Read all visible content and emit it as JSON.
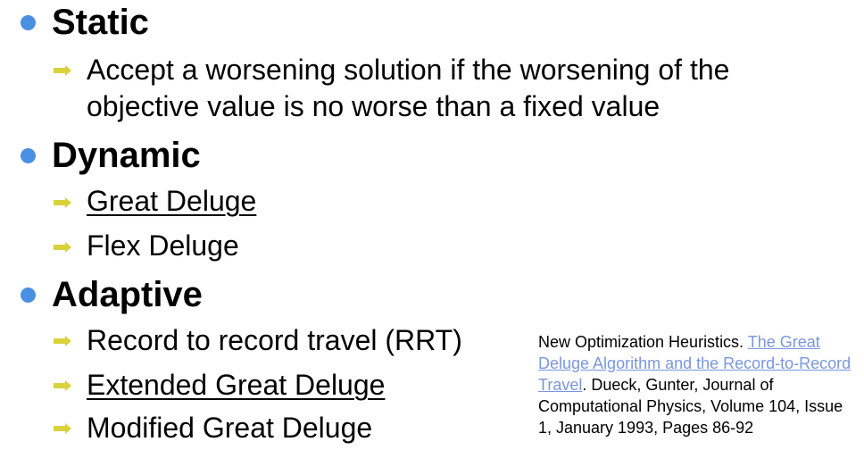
{
  "colors": {
    "heading_bullet": "#4a90e2",
    "sub_bullet": "#d9d23a",
    "link": "#7b96dd"
  },
  "icons": {
    "heading_bullet": "filled-circle",
    "sub_bullet": "right-arrow"
  },
  "sections": [
    {
      "heading": "Static",
      "items": [
        {
          "line1": "Accept a worsening solution if the worsening of the",
          "line2": "objective value is no worse than a fixed value",
          "underlined": false
        }
      ]
    },
    {
      "heading": "Dynamic",
      "items": [
        {
          "text": "Great Deluge",
          "underlined": true
        },
        {
          "text": "Flex Deluge",
          "underlined": false
        }
      ]
    },
    {
      "heading": "Adaptive",
      "items": [
        {
          "text": "Record to record travel (RRT)",
          "underlined": false
        },
        {
          "text": "Extended Great Deluge",
          "underlined": true
        },
        {
          "text": "Modified Great Deluge",
          "underlined": false
        }
      ]
    }
  ],
  "reference": {
    "prefix": "New Optimization Heuristics.",
    "link_text": "The Great Deluge Algorithm and the Record-to-Record Travel",
    "suffix": ". Dueck, Gunter, Journal of Computational Physics, Volume 104, Issue 1, January 1993, Pages 86-92"
  }
}
